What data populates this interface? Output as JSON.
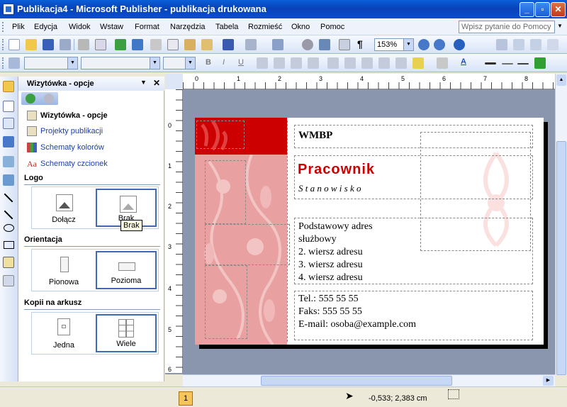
{
  "window": {
    "title": "Publikacja4 - Microsoft Publisher - publikacja drukowana",
    "min": "_",
    "max": "▫",
    "close": "✕"
  },
  "menu": [
    "Plik",
    "Edycja",
    "Widok",
    "Wstaw",
    "Format",
    "Narzędzia",
    "Tabela",
    "Rozmieść",
    "Okno",
    "Pomoc"
  ],
  "help_placeholder": "Wpisz pytanie do Pomocy",
  "zoom": "153%",
  "pane": {
    "title": "Wizytówka - opcje",
    "links": [
      "Wizytówka - opcje",
      "Projekty publikacji",
      "Schematy kolorów",
      "Schematy czcionek"
    ],
    "logo_section": "Logo",
    "logo_options": [
      "Dołącz",
      "Brak"
    ],
    "orient_section": "Orientacja",
    "orient_options": [
      "Pionowa",
      "Pozioma"
    ],
    "copies_section": "Kopii na arkusz",
    "copies_options": [
      "Jedna",
      "Wiele"
    ],
    "tooltip": "Brak"
  },
  "ruler": {
    "h": [
      "0",
      "1",
      "2",
      "3",
      "4",
      "5",
      "6",
      "7",
      "8"
    ],
    "v": [
      "0",
      "1",
      "2",
      "3",
      "4",
      "5",
      "6"
    ]
  },
  "card": {
    "org": "WMBP",
    "name": "Pracownik",
    "position": "S t a n o w i s k o",
    "address": [
      "Podstawowy adres",
      "służbowy",
      "2. wiersz adresu",
      "3. wiersz adresu",
      "4. wiersz adresu"
    ],
    "phone": "Tel.: 555 55 55",
    "fax": "Faks: 555 55 55",
    "email": "E-mail: osoba@example.com"
  },
  "status": {
    "page": "1",
    "coords": "-0,533; 2,383 cm"
  },
  "colors": {
    "accent": "#cc0000",
    "titlebar": "#0a4ed0",
    "pink": "#e8a0a0"
  }
}
